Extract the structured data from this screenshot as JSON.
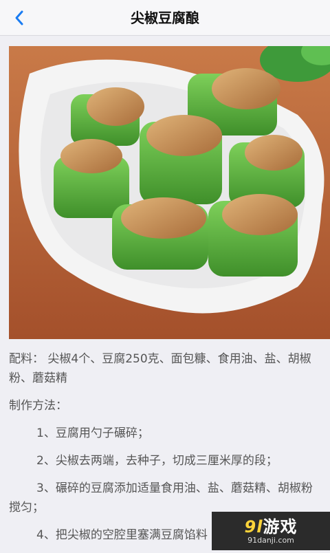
{
  "nav": {
    "title": "尖椒豆腐酿"
  },
  "recipe": {
    "ingredients": "配料： 尖椒4个、豆腐250克、面包糠、食用油、盐、胡椒粉、蘑菇精",
    "method_heading": "制作方法：",
    "steps": [
      "1、豆腐用勺子碾碎；",
      "2、尖椒去两端，去种子，切成三厘米厚的段；",
      "3、碾碎的豆腐添加适量食用油、盐、蘑菇精、胡椒粉搅匀；",
      "4、把尖椒的空腔里塞满豆腐馅料"
    ]
  },
  "watermark": {
    "logo_num": "9l",
    "logo_text": "游戏",
    "url": "91danji.com"
  },
  "colors": {
    "accent": "#1a7cf2",
    "text": "#555555"
  }
}
